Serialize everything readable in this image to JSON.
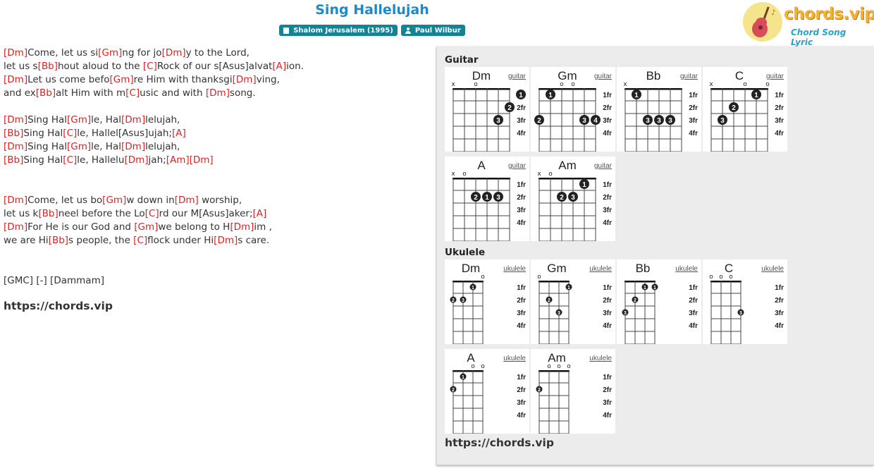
{
  "title": "Sing Hallelujah",
  "album": "Shalom Jerusalem (1995)",
  "artist": "Paul Wilbur",
  "logo": {
    "text": "chords.vip",
    "sub": "Chord Song Lyric"
  },
  "lyrics": [
    [
      [
        "c",
        "[Dm]"
      ],
      [
        "t",
        "Come, let us si"
      ],
      [
        "c",
        "[Gm]"
      ],
      [
        "t",
        "ng for jo"
      ],
      [
        "c",
        "[Dm]"
      ],
      [
        "t",
        "y to the Lord,"
      ]
    ],
    [
      [
        "t",
        "let us s"
      ],
      [
        "c",
        "[Bb]"
      ],
      [
        "t",
        "hout aloud to the "
      ],
      [
        "c",
        "[C]"
      ],
      [
        "t",
        "Rock of our s[Asus]alvat"
      ],
      [
        "c",
        "[A]"
      ],
      [
        "t",
        "ion."
      ]
    ],
    [
      [
        "c",
        "[Dm]"
      ],
      [
        "t",
        "Let us come befo"
      ],
      [
        "c",
        "[Gm]"
      ],
      [
        "t",
        "re Him with thanksgi"
      ],
      [
        "c",
        "[Dm]"
      ],
      [
        "t",
        "ving,"
      ]
    ],
    [
      [
        "t",
        "and ex"
      ],
      [
        "c",
        "[Bb]"
      ],
      [
        "t",
        "alt Him with m"
      ],
      [
        "c",
        "[C]"
      ],
      [
        "t",
        "usic and with "
      ],
      [
        "c",
        "[Dm]"
      ],
      [
        "t",
        "song."
      ]
    ],
    [],
    [
      [
        "c",
        "[Dm]"
      ],
      [
        "t",
        "Sing Hal"
      ],
      [
        "c",
        "[Gm]"
      ],
      [
        "t",
        "le, Hal"
      ],
      [
        "c",
        "[Dm]"
      ],
      [
        "t",
        "lelujah,"
      ]
    ],
    [
      [
        "c",
        "[Bb]"
      ],
      [
        "t",
        "Sing Hal"
      ],
      [
        "c",
        "[C]"
      ],
      [
        "t",
        "le, Hallel[Asus]ujah;"
      ],
      [
        "c",
        "[A]"
      ]
    ],
    [
      [
        "c",
        "[Dm]"
      ],
      [
        "t",
        "Sing Hal"
      ],
      [
        "c",
        "[Gm]"
      ],
      [
        "t",
        "le, Hal"
      ],
      [
        "c",
        "[Dm]"
      ],
      [
        "t",
        "lelujah,"
      ]
    ],
    [
      [
        "c",
        "[Bb]"
      ],
      [
        "t",
        "Sing Hal"
      ],
      [
        "c",
        "[C]"
      ],
      [
        "t",
        "le, Hallelu"
      ],
      [
        "c",
        "[Dm]"
      ],
      [
        "t",
        "jah;"
      ],
      [
        "c",
        "[Am]"
      ],
      [
        "c",
        "[Dm]"
      ]
    ],
    [],
    [],
    [
      [
        "c",
        "[Dm]"
      ],
      [
        "t",
        "Come, let us bo"
      ],
      [
        "c",
        "[Gm]"
      ],
      [
        "t",
        "w down in"
      ],
      [
        "c",
        "[Dm]"
      ],
      [
        "t",
        " worship,"
      ]
    ],
    [
      [
        "t",
        "let us k"
      ],
      [
        "c",
        "[Bb]"
      ],
      [
        "t",
        "neel before the Lo"
      ],
      [
        "c",
        "[C]"
      ],
      [
        "t",
        "rd our M[Asus]aker;"
      ],
      [
        "c",
        "[A]"
      ]
    ],
    [
      [
        "c",
        "[Dm]"
      ],
      [
        "t",
        "For He is our God and "
      ],
      [
        "c",
        "[Gm]"
      ],
      [
        "t",
        "we belong to H"
      ],
      [
        "c",
        "[Dm]"
      ],
      [
        "t",
        "im ,"
      ]
    ],
    [
      [
        "t",
        "we are Hi"
      ],
      [
        "c",
        "[Bb]"
      ],
      [
        "t",
        "s people, the "
      ],
      [
        "c",
        "[C]"
      ],
      [
        "t",
        "flock under Hi"
      ],
      [
        "c",
        "[Dm]"
      ],
      [
        "t",
        "s care."
      ]
    ],
    [],
    [],
    [
      [
        "t",
        "[GMC] [-] [Dammam]"
      ]
    ]
  ],
  "site_url": "https://chords.vip",
  "guitar_heading": "Guitar",
  "ukulele_heading": "Ukulele",
  "fret_labels": [
    "1fr",
    "2fr",
    "3fr",
    "4fr"
  ],
  "guitar_link": "guitar",
  "ukulele_link": "ukulele",
  "guitar_chords": [
    {
      "name": "Dm",
      "top": [
        "x",
        "",
        "o",
        "",
        "",
        ""
      ],
      "dots": [
        [
          6,
          1,
          "1"
        ],
        [
          5,
          2,
          "2"
        ],
        [
          4,
          3,
          "3"
        ]
      ]
    },
    {
      "name": "Gm",
      "top": [
        "",
        "",
        "o",
        "o",
        "",
        ""
      ],
      "dots": [
        [
          1,
          1,
          "1"
        ],
        [
          0,
          3,
          "2"
        ],
        [
          4,
          3,
          "3"
        ],
        [
          5,
          3,
          "4"
        ]
      ],
      "barre": [
        0,
        5,
        1
      ]
    },
    {
      "name": "Bb",
      "top": [
        "x",
        "",
        "",
        "",
        "",
        ""
      ],
      "dots": [
        [
          1,
          1,
          "1"
        ],
        [
          3,
          3,
          "3"
        ],
        [
          4,
          3,
          "3"
        ],
        [
          2,
          3,
          "3"
        ]
      ],
      "barre": [
        1,
        5,
        1
      ]
    },
    {
      "name": "C",
      "top": [
        "x",
        "",
        "",
        "o",
        "",
        "o"
      ],
      "dots": [
        [
          4,
          1,
          "1"
        ],
        [
          2,
          2,
          "2"
        ],
        [
          1,
          3,
          "3"
        ]
      ]
    },
    {
      "name": "A",
      "top": [
        "x",
        "o",
        "",
        "",
        "",
        ""
      ],
      "dots": [
        [
          2,
          2,
          "2"
        ],
        [
          3,
          2,
          "1"
        ],
        [
          4,
          2,
          "3"
        ]
      ]
    },
    {
      "name": "Am",
      "top": [
        "x",
        "o",
        "",
        "",
        "",
        ""
      ],
      "dots": [
        [
          4,
          1,
          "1"
        ],
        [
          2,
          2,
          "2"
        ],
        [
          3,
          2,
          "3"
        ]
      ]
    }
  ],
  "ukulele_chords": [
    {
      "name": "Dm",
      "top": [
        "",
        "",
        "",
        "o"
      ],
      "dots": [
        [
          2,
          1,
          "1"
        ],
        [
          0,
          2,
          "2"
        ],
        [
          1,
          2,
          "3"
        ]
      ]
    },
    {
      "name": "Gm",
      "top": [
        "o",
        "",
        "",
        ""
      ],
      "dots": [
        [
          3,
          1,
          "1"
        ],
        [
          1,
          2,
          "2"
        ],
        [
          2,
          3,
          "3"
        ]
      ]
    },
    {
      "name": "Bb",
      "top": [
        "",
        "",
        "",
        ""
      ],
      "dots": [
        [
          2,
          1,
          "1"
        ],
        [
          3,
          1,
          "1"
        ],
        [
          1,
          2,
          "2"
        ],
        [
          0,
          3,
          "3"
        ]
      ]
    },
    {
      "name": "C",
      "top": [
        "o",
        "o",
        "o",
        ""
      ],
      "dots": [
        [
          3,
          3,
          "3"
        ]
      ]
    },
    {
      "name": "A",
      "top": [
        "",
        "",
        "o",
        "o"
      ],
      "dots": [
        [
          1,
          1,
          "1"
        ],
        [
          0,
          2,
          "2"
        ]
      ]
    },
    {
      "name": "Am",
      "top": [
        "",
        "o",
        "o",
        "o"
      ],
      "dots": [
        [
          0,
          2,
          "2"
        ]
      ]
    }
  ]
}
